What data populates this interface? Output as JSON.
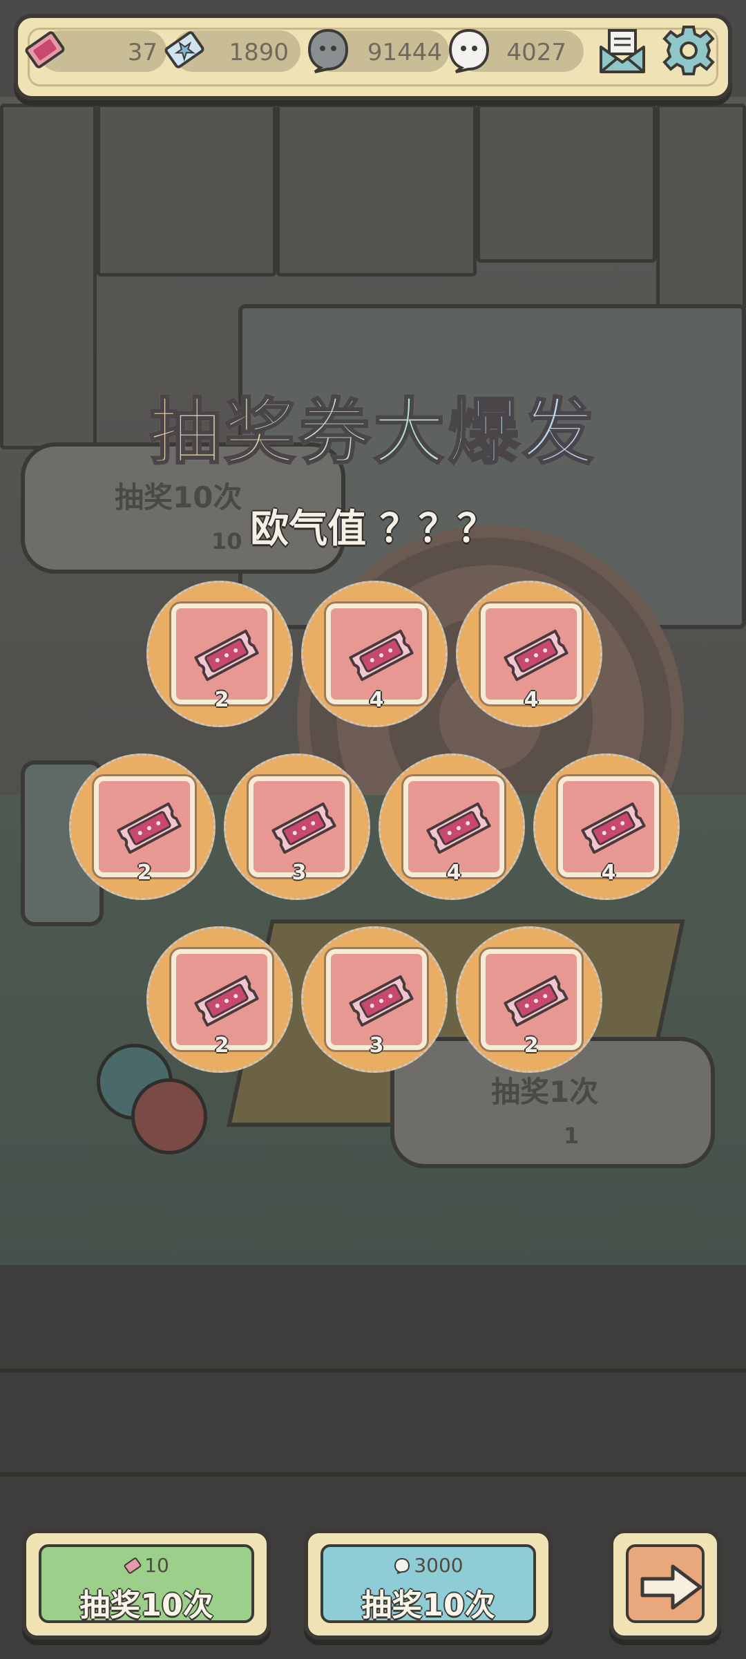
{
  "resources": [
    {
      "name": "ticket",
      "value": "37"
    },
    {
      "name": "star-ticket",
      "value": "1890"
    },
    {
      "name": "dark-ghost",
      "value": "91444"
    },
    {
      "name": "white-ghost",
      "value": "4027"
    }
  ],
  "background": {
    "ghost_button_large": {
      "label": "抽奖10次",
      "cost": "10"
    },
    "ghost_button_small": {
      "label": "抽奖1次",
      "cost": "1"
    }
  },
  "popup": {
    "title": "抽奖券大爆发",
    "subtitle": "欧气值 ？？？",
    "prizes": [
      {
        "icon": "ticket-icon",
        "count": "2"
      },
      {
        "icon": "ticket-icon",
        "count": "4"
      },
      {
        "icon": "ticket-icon",
        "count": "4"
      },
      {
        "icon": "ticket-icon",
        "count": "2"
      },
      {
        "icon": "ticket-icon",
        "count": "3"
      },
      {
        "icon": "ticket-icon",
        "count": "4"
      },
      {
        "icon": "ticket-icon",
        "count": "4"
      },
      {
        "icon": "ticket-icon",
        "count": "2"
      },
      {
        "icon": "ticket-icon",
        "count": "3"
      },
      {
        "icon": "ticket-icon",
        "count": "2"
      }
    ]
  },
  "buttons": {
    "draw_ticket": {
      "cost": "10",
      "label": "抽奖10次",
      "color": "#9ccf8a"
    },
    "draw_ghost": {
      "cost": "3000",
      "label": "抽奖10次",
      "color": "#8fcdd6"
    },
    "next": {
      "icon": "arrow-right-icon",
      "color": "#e9a77c"
    }
  },
  "colors": {
    "bar_bg": "#efe3b6",
    "prize_circle": "#e9ad63",
    "prize_card": "#e79893",
    "ticket_pink": "#c8496f"
  }
}
